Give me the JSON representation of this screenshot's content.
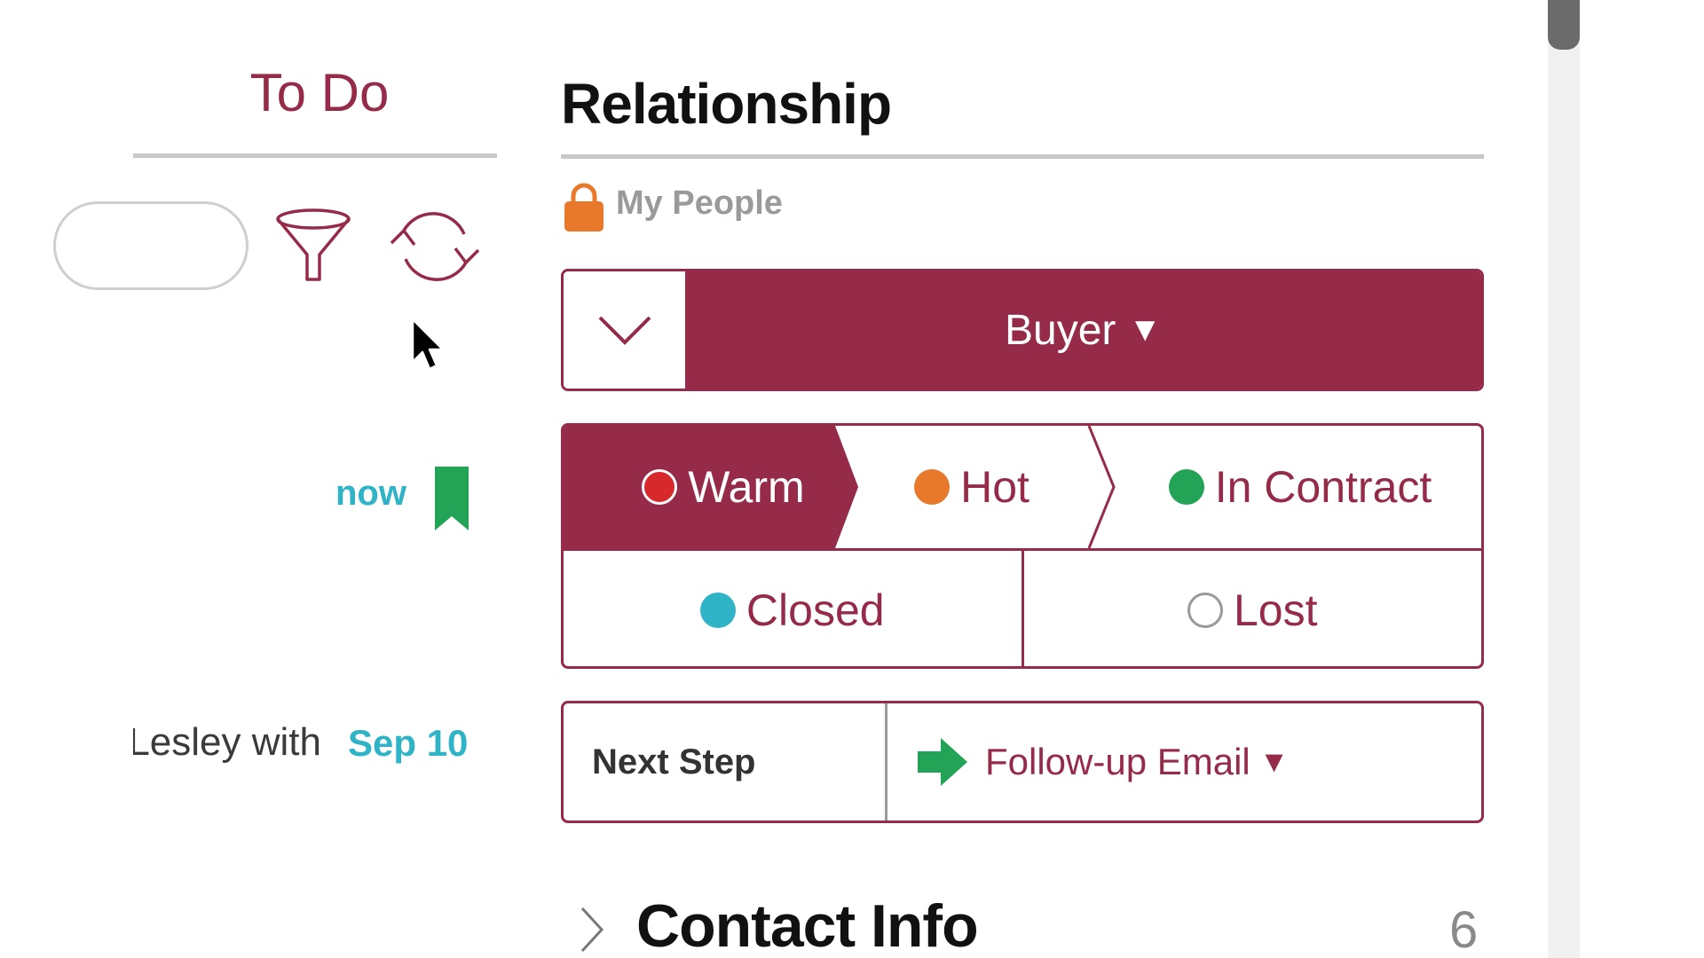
{
  "todo": {
    "title": "To Do",
    "now_label": "now",
    "task_text": "Lesley with...",
    "task_date": "Sep 10"
  },
  "relationship": {
    "title": "Relationship",
    "visibility_label": "My People",
    "type_value": "Buyer",
    "type_caret": "▼",
    "stages": {
      "warm": "Warm",
      "hot": "Hot",
      "in_contract": "In Contract",
      "closed": "Closed",
      "lost": "Lost"
    },
    "selected_stage": "Warm",
    "next_step": {
      "label": "Next Step",
      "value": "Follow-up Email",
      "caret": "▼"
    }
  },
  "contact_info": {
    "title": "Contact Info",
    "count": "6"
  },
  "colors": {
    "brand": "#962a49",
    "accent_teal": "#2fb3c6",
    "warm_dot": "#d7282b",
    "hot_dot": "#e8782a",
    "contract_dot": "#22a355",
    "closed_dot": "#2fb3c6",
    "bookmark": "#22a355",
    "lock": "#e8782a"
  },
  "icons": {
    "filter": "funnel-icon",
    "refresh": "refresh-icon",
    "bookmark": "bookmark-icon",
    "lock": "lock-icon",
    "dropdown_toggle": "chevron-down-icon",
    "next_step_arrow": "arrow-right-icon",
    "expand": "chevron-right-icon"
  }
}
